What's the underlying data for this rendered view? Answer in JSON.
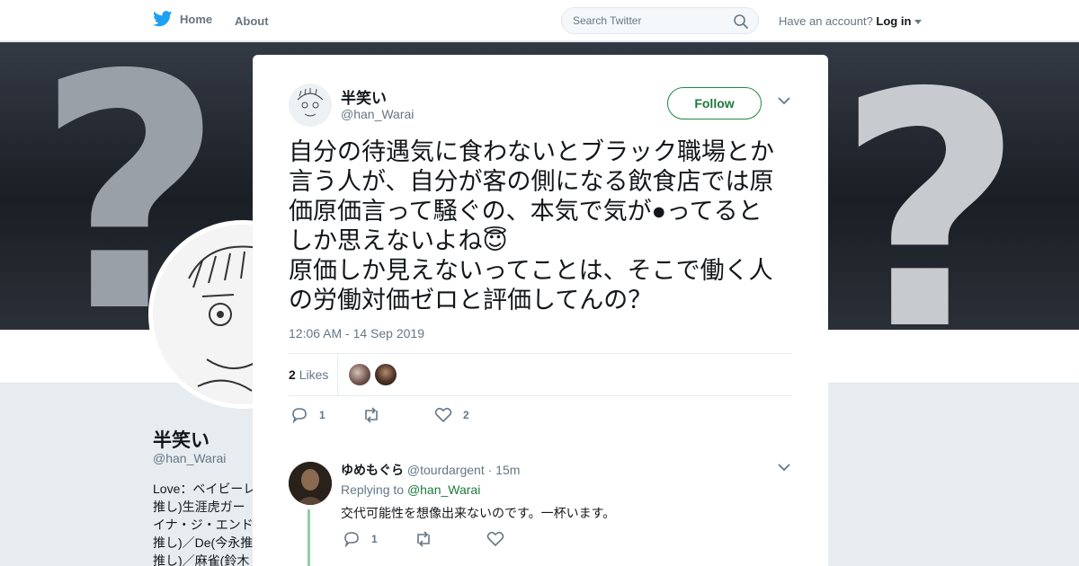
{
  "nav": {
    "home_label": "Home",
    "about_label": "About",
    "search_placeholder": "Search Twitter",
    "account_text": "Have an account?",
    "login_label": "Log in"
  },
  "profile": {
    "name": "半笑い",
    "handle": "@han_Warai",
    "bio_lines": [
      "Love：ベイビーレ",
      "推し)生涯虎ガー",
      "イナ・ジ・エンド",
      "推し)／De(今永推",
      "推し)／麻雀(鈴木"
    ]
  },
  "tweet": {
    "author_name": "半笑い",
    "author_handle": "@han_Warai",
    "follow_label": "Follow",
    "text_lines": [
      "自分の待遇気に食わないとブラック職場とか",
      "言う人が、自分が客の側になる飲食店では原",
      "価原価言って騒ぐの、本気で気が●ってると",
      "しか思えないよね😇",
      "原価しか見えないってことは、そこで働く人",
      "の労働対価ゼロと評価してんの？"
    ],
    "timestamp": "12:06 AM - 14 Sep 2019",
    "likes_count": "2",
    "likes_label": "Likes",
    "reply_count": "1",
    "like_count": "2"
  },
  "reply": {
    "name": "ゆめもぐら",
    "handle": "@tourdargent",
    "time": "· 15m",
    "replying_to_label": "Replying to",
    "replying_to_handle": "@han_Warai",
    "text": "交代可能性を想像出来ないのです。一杯います。",
    "reply_count": "1"
  },
  "colors": {
    "brand_blue": "#1da1f2",
    "follow_green": "#1c7a3b",
    "thread_line": "#8fd0a6",
    "muted_text": "#657786"
  }
}
